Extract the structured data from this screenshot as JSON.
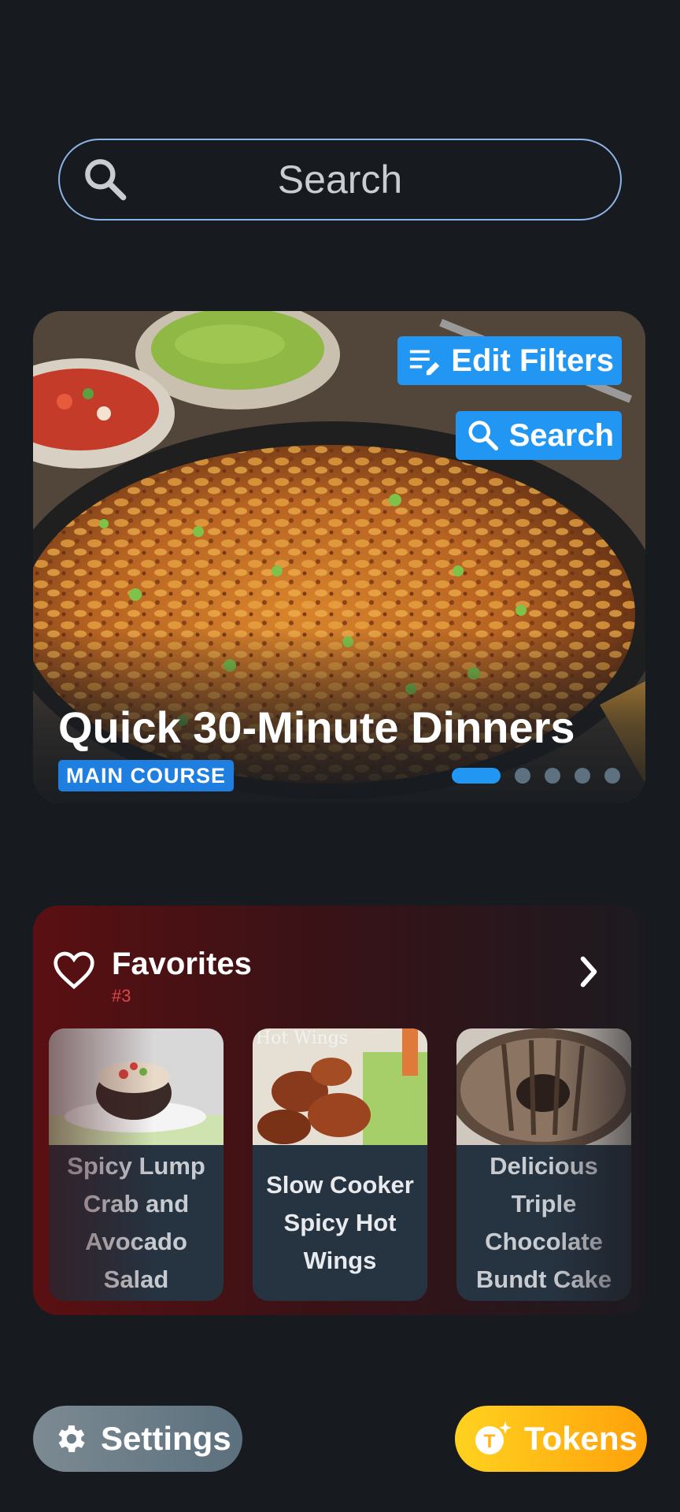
{
  "search": {
    "placeholder": "Search"
  },
  "hero": {
    "title": "Quick 30-Minute Dinners",
    "category": "MAIN COURSE",
    "edit_filters_label": "Edit Filters",
    "search_label": "Search",
    "page_count": 5,
    "active_page": 1
  },
  "favorites": {
    "title": "Favorites",
    "rank": "#3",
    "items": [
      {
        "name": "Spicy Lump Crab and Avocado Salad"
      },
      {
        "name": "Slow Cooker Spicy Hot Wings",
        "image_caption": "Hot Wings"
      },
      {
        "name": "Delicious Triple Chocolate Bundt Cake"
      }
    ]
  },
  "footer": {
    "settings_label": "Settings",
    "tokens_label": "Tokens"
  },
  "colors": {
    "background": "#171b20",
    "accent": "#2196f3",
    "favorites_rank": "#e0464c",
    "tokens_gradient_start": "#ffd21f",
    "tokens_gradient_end": "#ffa10a"
  },
  "icons": [
    "search-icon",
    "edit-filter-icon",
    "heart-icon",
    "chevron-right-icon",
    "gear-icon",
    "token-icon"
  ]
}
